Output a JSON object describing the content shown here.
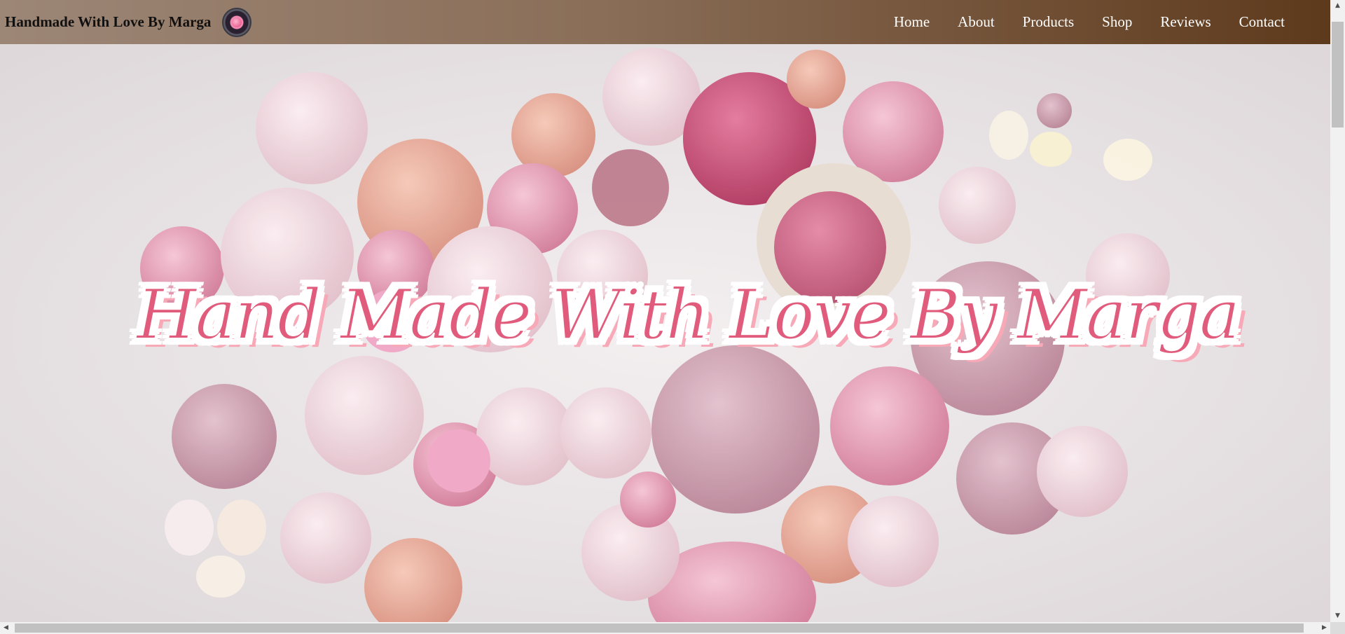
{
  "header": {
    "brand_title": "Handmade With Love By Marga",
    "logo_icon": "yarn-logo-icon"
  },
  "nav": {
    "items": [
      {
        "label": "Home"
      },
      {
        "label": "About"
      },
      {
        "label": "Products"
      },
      {
        "label": "Shop"
      },
      {
        "label": "Reviews"
      },
      {
        "label": "Contact"
      }
    ]
  },
  "hero": {
    "title": "Hand Made With Love By Marga",
    "image_subject": "pink-yarn-balls-background"
  },
  "colors": {
    "navbar_start": "#9c8676",
    "navbar_end": "#5e3a1c",
    "hero_title": "#e15c7c",
    "hero_title_outline": "#ffffff"
  },
  "scrollbars": {
    "up_arrow": "▲",
    "down_arrow": "▼",
    "left_arrow": "◀",
    "right_arrow": "▶"
  }
}
